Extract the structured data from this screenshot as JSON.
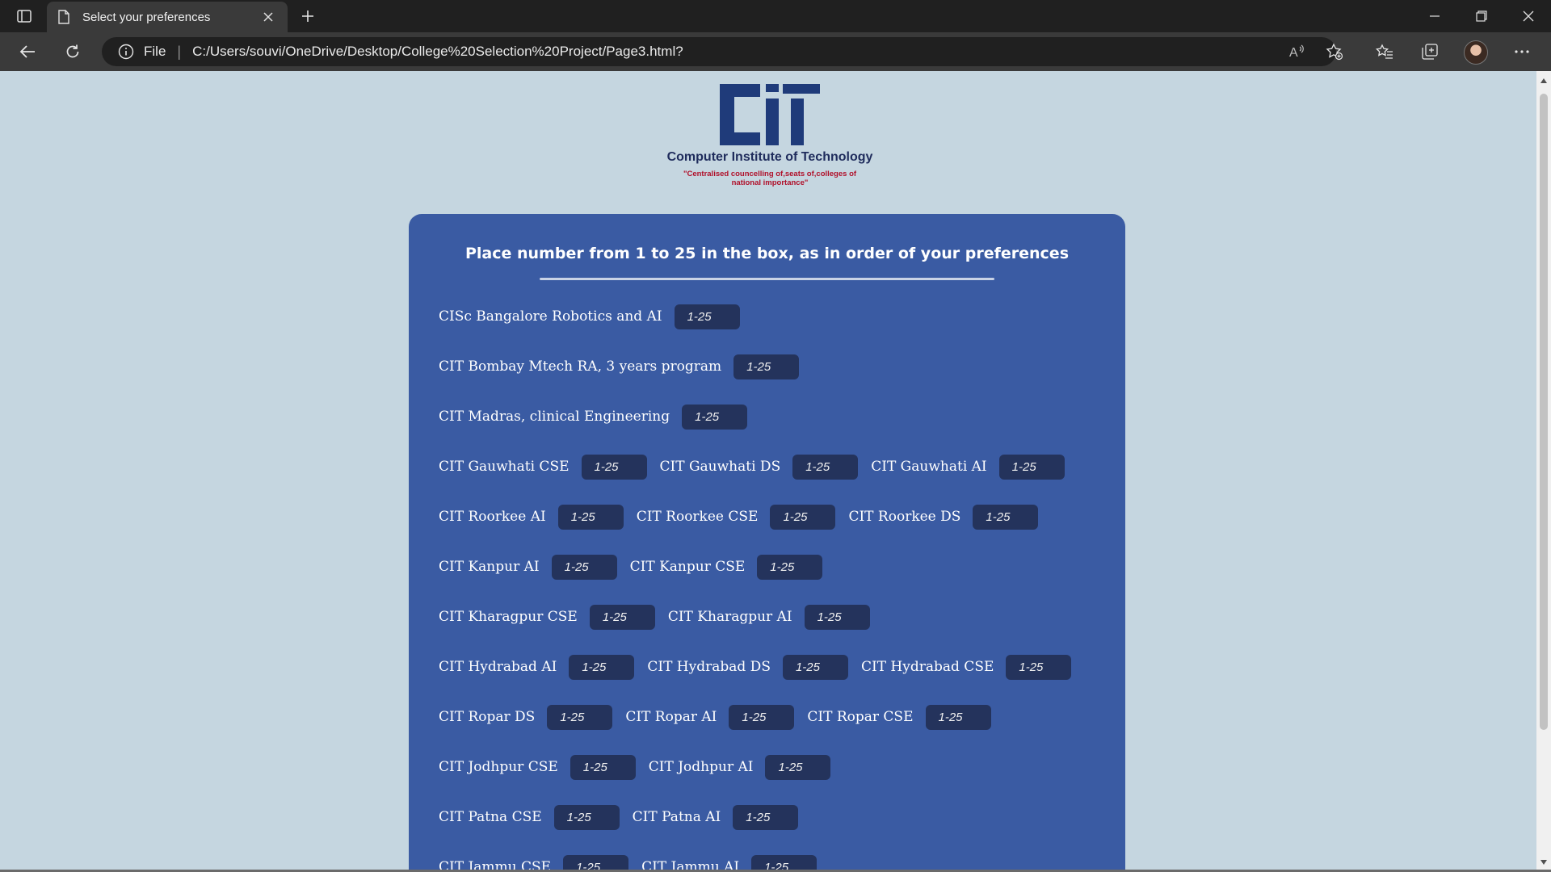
{
  "browser": {
    "tab_title": "Select your preferences",
    "address_scheme": "File",
    "address_url": "C:/Users/souvi/OneDrive/Desktop/College%20Selection%20Project/Page3.html?"
  },
  "logo": {
    "wordmark": "CIT",
    "institute_name": "Computer Institute of Technology",
    "tagline": "\"Centralised councelling of,seats of,colleges of national importance\""
  },
  "card": {
    "title": "Place number from 1 to 25 in the box, as in order of your preferences",
    "input_placeholder": "1-25",
    "rows": [
      [
        {
          "label": "CISc Bangalore Robotics and AI"
        }
      ],
      [
        {
          "label": "CIT Bombay Mtech RA, 3 years program"
        }
      ],
      [
        {
          "label": "CIT Madras, clinical Engineering"
        }
      ],
      [
        {
          "label": "CIT Gauwhati CSE"
        },
        {
          "label": "CIT Gauwhati DS"
        },
        {
          "label": "CIT Gauwhati AI"
        }
      ],
      [
        {
          "label": "CIT Roorkee AI"
        },
        {
          "label": "CIT Roorkee CSE"
        },
        {
          "label": "CIT Roorkee DS"
        }
      ],
      [
        {
          "label": "CIT Kanpur AI"
        },
        {
          "label": "CIT Kanpur CSE"
        }
      ],
      [
        {
          "label": "CIT Kharagpur CSE"
        },
        {
          "label": "CIT Kharagpur AI"
        }
      ],
      [
        {
          "label": "CIT Hydrabad AI"
        },
        {
          "label": "CIT Hydrabad DS"
        },
        {
          "label": "CIT Hydrabad CSE"
        }
      ],
      [
        {
          "label": "CIT Ropar DS"
        },
        {
          "label": "CIT Ropar AI"
        },
        {
          "label": "CIT Ropar CSE"
        }
      ],
      [
        {
          "label": "CIT Jodhpur CSE"
        },
        {
          "label": "CIT Jodhpur AI"
        }
      ],
      [
        {
          "label": "CIT Patna CSE"
        },
        {
          "label": "CIT Patna AI"
        }
      ],
      [
        {
          "label": "CIT Jammu CSE"
        },
        {
          "label": "CIT Jammu AI"
        }
      ]
    ]
  },
  "colors": {
    "page_bg": "#c5d6e0",
    "card_bg": "#3a5ba3",
    "input_bg": "#24335c",
    "logo_blue": "#1f2c5c",
    "tagline_red": "#b0102a"
  },
  "icons": {
    "tab_actions": "tab-actions-icon",
    "page": "page-icon",
    "close": "close-icon",
    "new_tab": "plus-icon",
    "back": "back-arrow-icon",
    "refresh": "refresh-icon",
    "info": "info-icon",
    "read_aloud": "read-aloud-icon",
    "add_favorite": "star-plus-icon",
    "favorites": "favorites-icon",
    "collections": "collections-icon",
    "more": "more-dots-icon"
  }
}
